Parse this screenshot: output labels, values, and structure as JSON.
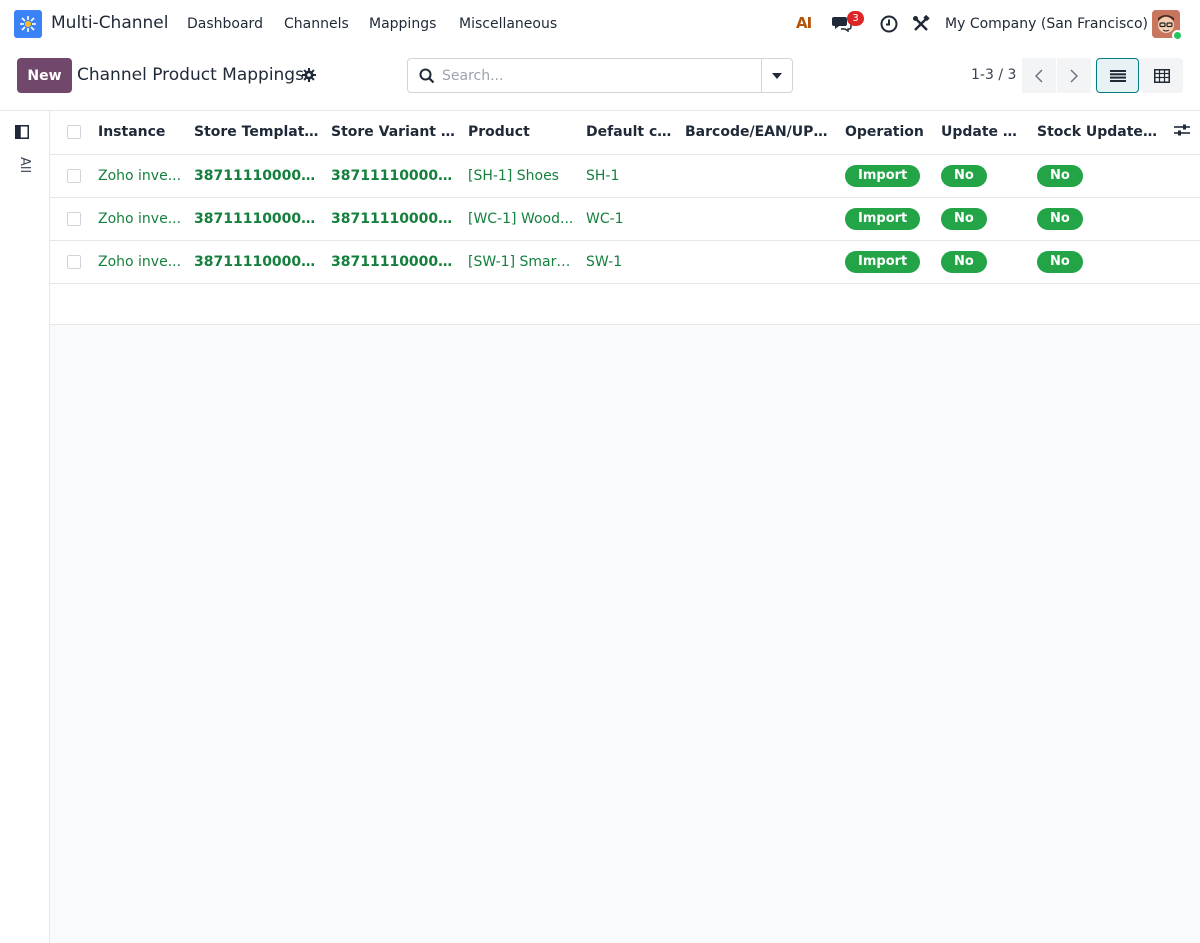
{
  "topnav": {
    "app_name": "Multi-Channel",
    "menu": [
      "Dashboard",
      "Channels",
      "Mappings",
      "Miscellaneous"
    ],
    "ai_label": "AI",
    "messages_badge": "3",
    "company": "My Company (San Francisco)"
  },
  "control": {
    "new_label": "New",
    "title": "Channel Product Mappings",
    "search_placeholder": "Search...",
    "pager": "1-3 / 3"
  },
  "sidepanel": {
    "filter_label": "All"
  },
  "table": {
    "columns": [
      "Instance",
      "Store Template ID",
      "Store Variant ID",
      "Product",
      "Default co...",
      "Barcode/EAN/UPC ...",
      "Operation",
      "Update R...",
      "Stock Update R..."
    ],
    "rows": [
      {
        "instance": "Zoho inve...",
        "template_id": "3871111000000...",
        "variant_id": "3871111000000...",
        "product": "[SH-1] Shoes",
        "default_code": "SH-1",
        "barcode": "",
        "operation": "Import",
        "update": "No",
        "stock_update": "No"
      },
      {
        "instance": "Zoho inve...",
        "template_id": "3871111000000...",
        "variant_id": "3871111000000...",
        "product": "[WC-1] Wood...",
        "default_code": "WC-1",
        "barcode": "",
        "operation": "Import",
        "update": "No",
        "stock_update": "No"
      },
      {
        "instance": "Zoho inve...",
        "template_id": "3871111000000...",
        "variant_id": "3871111000000...",
        "product": "[SW-1] Smart...",
        "default_code": "SW-1",
        "barcode": "",
        "operation": "Import",
        "update": "No",
        "stock_update": "No"
      }
    ]
  },
  "colors": {
    "brand": "#71476b",
    "accent": "#017e84",
    "tag_green": "#22a447",
    "link_green": "#15803d"
  }
}
